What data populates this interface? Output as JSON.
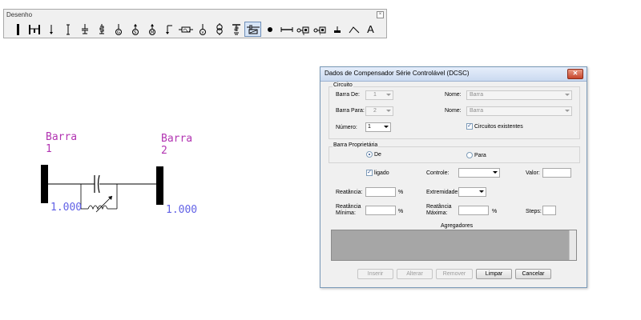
{
  "toolbar": {
    "title": "Desenho",
    "icons": [
      "bus-icon",
      "bus-section-icon",
      "load-icon",
      "line-icon",
      "shunt-capacitor-icon",
      "shunt-reactor-icon",
      "generator-icon",
      "synchronous-machine-icon",
      "motor-icon",
      "arrow-load-icon",
      "series-device-icon",
      "ground-source-icon",
      "transformer-icon",
      "grounding-icon",
      "dcsc-icon",
      "node-icon",
      "branch-icon",
      "converter-icon",
      "converter2-icon",
      "ground-icon",
      "curve-icon",
      "text-icon"
    ],
    "text_tool_label": "A",
    "active_icon": "dcsc-icon"
  },
  "diagram": {
    "bus_from": {
      "name_line1": "Barra",
      "name_line2": "1",
      "value": "1.000"
    },
    "bus_to": {
      "name_line1": "Barra",
      "name_line2": "2",
      "value": "1.000"
    }
  },
  "dialog": {
    "title": "Dados de Compensador Série Controlável (DCSC)",
    "circuito": {
      "legend": "Circuito",
      "barra_de_label": "Barra De:",
      "barra_de_value": "1",
      "nome_label_1": "Nome:",
      "nome_value_1": "Barra",
      "barra_para_label": "Barra Para:",
      "barra_para_value": "2",
      "nome_label_2": "Nome:",
      "nome_value_2": "Barra",
      "numero_label": "Número:",
      "numero_value": "1",
      "circuitos_existentes_label": "Circuitos existentes"
    },
    "barra_proprietaria": {
      "legend": "Barra Proprietária",
      "de_label": "De",
      "para_label": "Para"
    },
    "ligado_label": "ligado",
    "controle_label": "Controle:",
    "valor_label": "Valor:",
    "reatancia_label": "Reatância:",
    "percent": "%",
    "extremidade_label": "Extremidade:",
    "reatancia_minima_label_1": "Reatância",
    "reatancia_minima_label_2": "Mínima:",
    "reatancia_maxima_label_1": "Reatância",
    "reatancia_maxima_label_2": "Máxima:",
    "steps_label": "Steps:",
    "agregadores_label": "Agregadores",
    "buttons": {
      "inserir": "Inserir",
      "alterar": "Alterar",
      "remover": "Remover",
      "limpar": "Limpar",
      "cancelar": "Cancelar"
    },
    "close_glyph": "✕"
  }
}
